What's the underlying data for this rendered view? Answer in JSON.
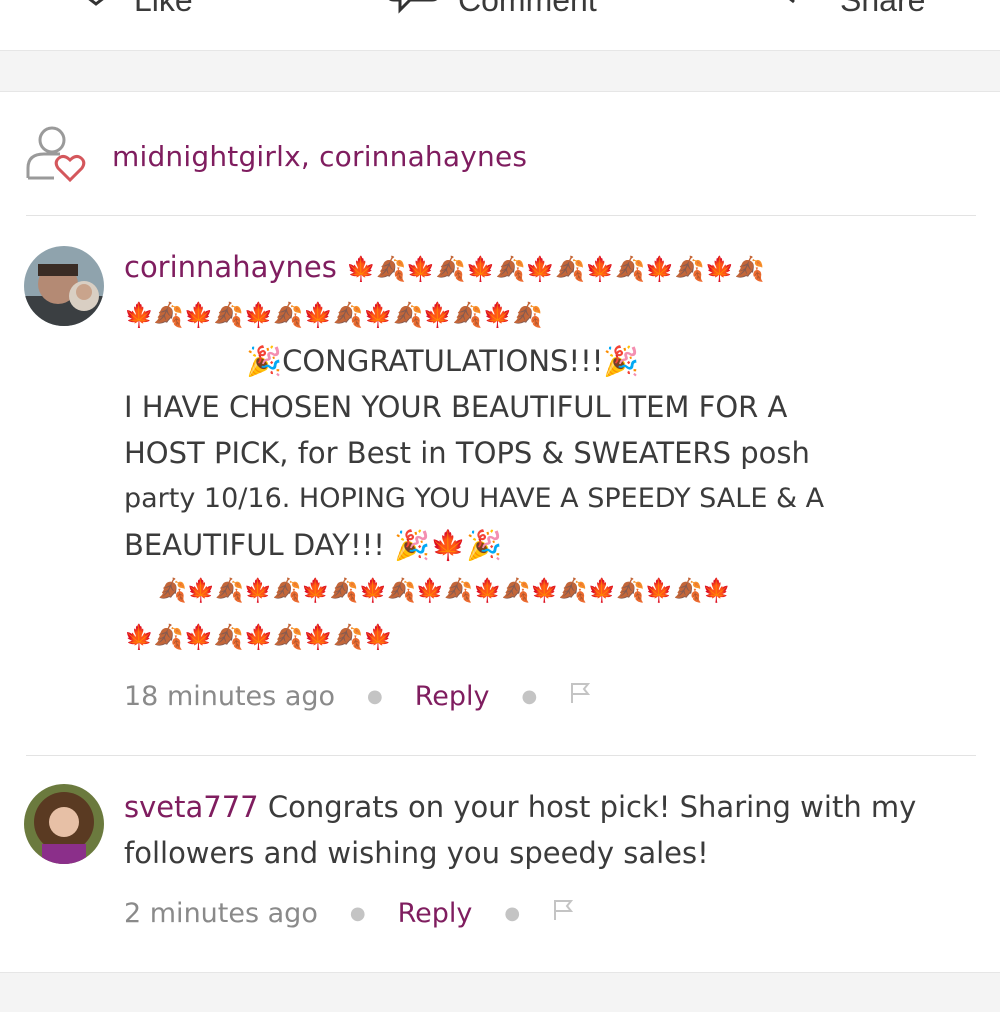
{
  "actions": {
    "like_label": "Like",
    "comment_label": "Comment",
    "share_label": "Share"
  },
  "likers": {
    "text": "midnightgirlx, corinnahaynes"
  },
  "comments": [
    {
      "username": "corinnahaynes",
      "lines": [
        "🍁🍂🍁🍂🍁🍂🍁🍂🍁🍂🍁🍂🍁🍂",
        "🍁🍂🍁🍂🍁🍂🍁🍂🍁🍂🍁🍂🍁🍂",
        "🎉CONGRATULATIONS!!!🎉",
        "I HAVE CHOSEN YOUR BEAUTIFUL ITEM FOR A",
        "HOST PICK, for Best in TOPS & SWEATERS posh",
        "party 10/16. HOPING YOU HAVE A SPEEDY SALE & A",
        "BEAUTIFUL DAY!!! 🎉🍁🎉",
        "🍂🍁🍂🍁🍂🍁🍂🍁🍂🍁🍂🍁🍂🍁🍂🍁🍂🍁🍂🍁",
        "🍁🍂🍁🍂🍁🍂🍁🍂🍁"
      ],
      "time": "18 minutes ago",
      "reply_label": "Reply"
    },
    {
      "username": "sveta777",
      "lines": [
        " Congrats on your host pick! Sharing with my",
        "followers and wishing you speedy sales!"
      ],
      "time": "2 minutes ago",
      "reply_label": "Reply"
    }
  ],
  "colors": {
    "accent": "#7f1d5f",
    "heart": "#d4575c",
    "muted": "#8a8a8a"
  }
}
